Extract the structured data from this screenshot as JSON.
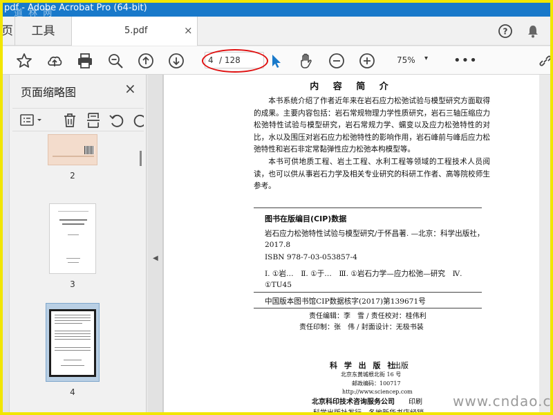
{
  "window": {
    "title": "pdf - Adobe Acrobat Pro (64-bit)",
    "watermark_top": "道 林 网"
  },
  "tabs": {
    "home": "页",
    "tools": "工具",
    "doc": "5.pdf",
    "doc_close": "×"
  },
  "toolbar": {
    "page_current": "4",
    "page_total": "/ 128",
    "zoom": "75%",
    "zoom_caret": "▾",
    "more": "•••",
    "accent": "#1979ca",
    "highlight": "#e01010"
  },
  "sidebar": {
    "title": "页面缩略图",
    "close": "×",
    "view_caret": "▾",
    "thumbnails": [
      {
        "num": "2"
      },
      {
        "num": "3"
      },
      {
        "num": "4",
        "selected": true
      }
    ]
  },
  "page": {
    "heading": "内 容 简 介",
    "summary_p1": "本书系统介绍了作者近年来在岩石应力松弛试验与模型研究方面取得的成果。主要内容包括：岩石常规物理力学性质研究，岩石三轴压缩应力松弛特性试验与模型研究，岩石常规力学、蠕变以及应力松弛特性的对比，水以及围压对岩石应力松弛特性的影响作用，岩石峰前与峰后应力松弛特性和岩石非定常黏弹性应力松弛本构模型等。",
    "summary_p2": "本书可供地质工程、岩土工程、水利工程等领域的工程技术人员阅读，也可以供从事岩石力学及相关专业研究的科研工作者、高等院校师生参考。",
    "cip_title": "图书在版编目(CIP)数据",
    "cip_line1": "岩石应力松弛特性试验与模型研究/于怀昌著. —北京：科学出版社，2017.8",
    "cip_isbn": "ISBN 978-7-03-053857-4",
    "cip_class": "Ⅰ. ①岩…　Ⅱ. ①于…　Ⅲ. ①岩石力学—应力松弛—研究　Ⅳ. ①TU45",
    "cip_number": "中国版本图书馆CIP数据核字(2017)第139671号",
    "credit1": "责任编辑：李　雪 / 责任校对：桂伟利",
    "credit2": "责任印制：张　伟 / 封面设计：无极书装",
    "publisher": "科 学 出 版 社",
    "publisher_suffix": "出版",
    "address": "北京东黄城根北街 16 号",
    "postcode": "邮政编码：100717",
    "website": "http://www.sciencep.com",
    "printer": "北京科印技术咨询服务公司",
    "printer_suffix": "印刷",
    "distribution": "科学出版社发行　各地新华书店经销"
  },
  "watermark_bottom": "www.cndao.com"
}
